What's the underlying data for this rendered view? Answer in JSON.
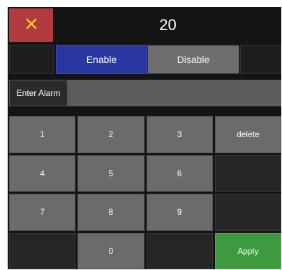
{
  "close_icon": "close-icon",
  "colors": {
    "close_bg": "#b23a3c",
    "close_icon": "#f2d020",
    "enable_bg": "#2a37a1",
    "disable_bg": "#6e6e6e",
    "key_bg": "#6b6b6b",
    "apply_bg": "#3e9a3e",
    "panel_bg": "#141414"
  },
  "display": {
    "value": "20"
  },
  "toggle": {
    "enable_label": "Enable",
    "disable_label": "Disable",
    "selected": "Enable"
  },
  "alarm": {
    "label": "Enter Alarm",
    "value": "",
    "placeholder": ""
  },
  "keypad": {
    "keys": [
      "1",
      "2",
      "3",
      "delete",
      "4",
      "5",
      "6",
      "",
      "7",
      "8",
      "9",
      "",
      "",
      "0",
      "",
      "Apply"
    ]
  }
}
